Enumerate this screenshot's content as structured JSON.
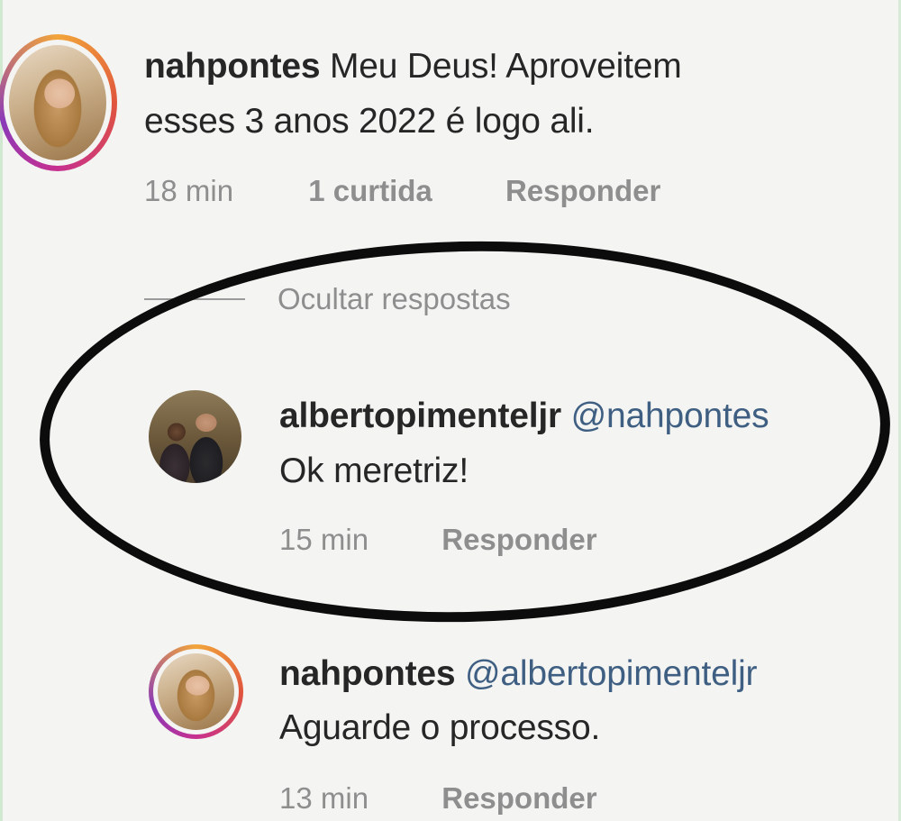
{
  "comments": [
    {
      "username": "nahpontes",
      "text_line1": "Meu Deus! Aproveitem",
      "text_line2": "esses 3 anos 2022 é logo ali.",
      "time": "18 min",
      "likes": "1 curtida",
      "reply_label": "Responder"
    },
    {
      "username": "albertopimenteljr",
      "mention": "@nahpontes",
      "text": "Ok meretriz!",
      "time": "15 min",
      "reply_label": "Responder"
    },
    {
      "username": "nahpontes",
      "mention": "@albertopimenteljr",
      "text": "Aguarde o processo.",
      "time": "13 min",
      "reply_label": "Responder"
    }
  ],
  "thread": {
    "hide_replies_label": "Ocultar respostas"
  },
  "colors": {
    "text": "#262626",
    "meta": "#8e8e8e",
    "mention": "#3f5f82",
    "highlight_ellipse": "#0c0c0c"
  },
  "icons": {
    "avatar_story_ring": "instagram-story-ring"
  }
}
